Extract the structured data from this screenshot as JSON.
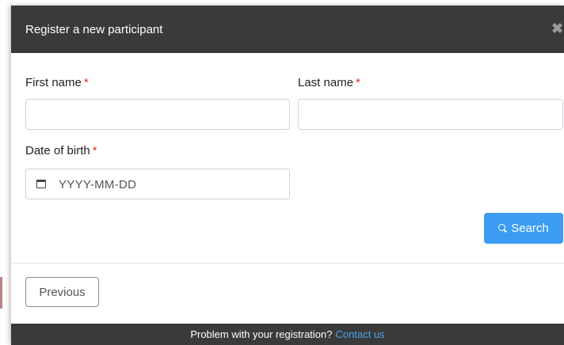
{
  "modal": {
    "title": "Register a new participant",
    "close_symbol": "✖"
  },
  "form": {
    "first_name_label": "First name",
    "last_name_label": "Last name",
    "dob_label": "Date of birth",
    "required_marker": "*",
    "first_name_value": "",
    "last_name_value": "",
    "dob_placeholder": "YYYY-MM-DD"
  },
  "actions": {
    "search_label": "Search",
    "previous_label": "Previous"
  },
  "footer": {
    "text": "Problem with your registration?",
    "link_text": "Contact us"
  },
  "colors": {
    "header_bg": "#3a3a3a",
    "accent": "#3b9cf2",
    "required": "#d9302a"
  },
  "icons": {
    "close": "close-icon",
    "calendar": "calendar-icon",
    "search": "search-icon"
  }
}
